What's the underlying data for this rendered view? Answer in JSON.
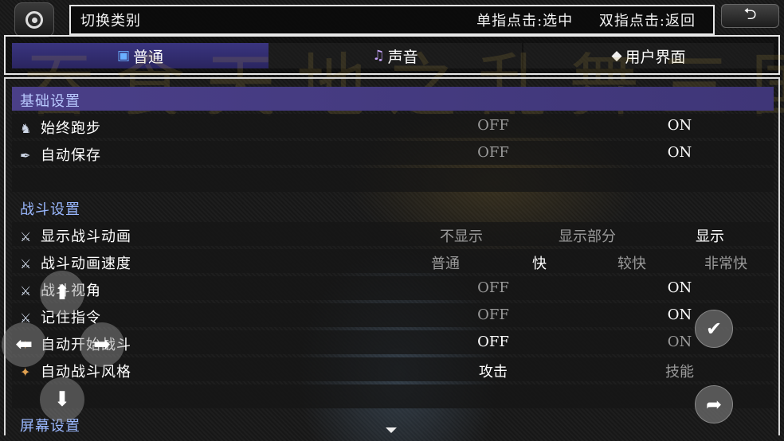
{
  "header": {
    "title": "切换类别",
    "hint_tap": "单指点击:选中",
    "hint_double": "双指点击:返回"
  },
  "background_title": "吞食天地之乱舞三国",
  "tabs": [
    {
      "label": "普通",
      "icon": "monitor-icon"
    },
    {
      "label": "声音",
      "icon": "harp-icon"
    },
    {
      "label": "用户界面",
      "icon": "diamond-icon"
    }
  ],
  "sections": {
    "basic": "基础设置",
    "battle": "战斗设置",
    "screen": "屏幕设置"
  },
  "settings": {
    "always_run": {
      "label": "始终跑步",
      "opt1": "OFF",
      "opt2": "ON"
    },
    "auto_save": {
      "label": "自动保存",
      "opt1": "OFF",
      "opt2": "ON"
    },
    "show_anim": {
      "label": "显示战斗动画",
      "opt1": "不显示",
      "opt2": "显示部分",
      "opt3": "显示"
    },
    "anim_speed": {
      "label": "战斗动画速度",
      "opt1": "普通",
      "opt2": "快",
      "opt3": "较快",
      "opt4": "非常快"
    },
    "view_angle": {
      "label": "战斗视角",
      "opt1": "OFF",
      "opt2": "ON"
    },
    "remember_cmd": {
      "label": "记住指令",
      "opt1": "OFF",
      "opt2": "ON"
    },
    "auto_start": {
      "label": "自动开始战斗",
      "opt1": "OFF",
      "opt2": "ON"
    },
    "auto_style": {
      "label": "自动战斗风格",
      "opt1": "攻击",
      "opt2": "技能"
    }
  },
  "colors": {
    "active_tab": "#3a3580",
    "section_highlight": "#4a3f88",
    "section_text": "#9ab8ff"
  }
}
